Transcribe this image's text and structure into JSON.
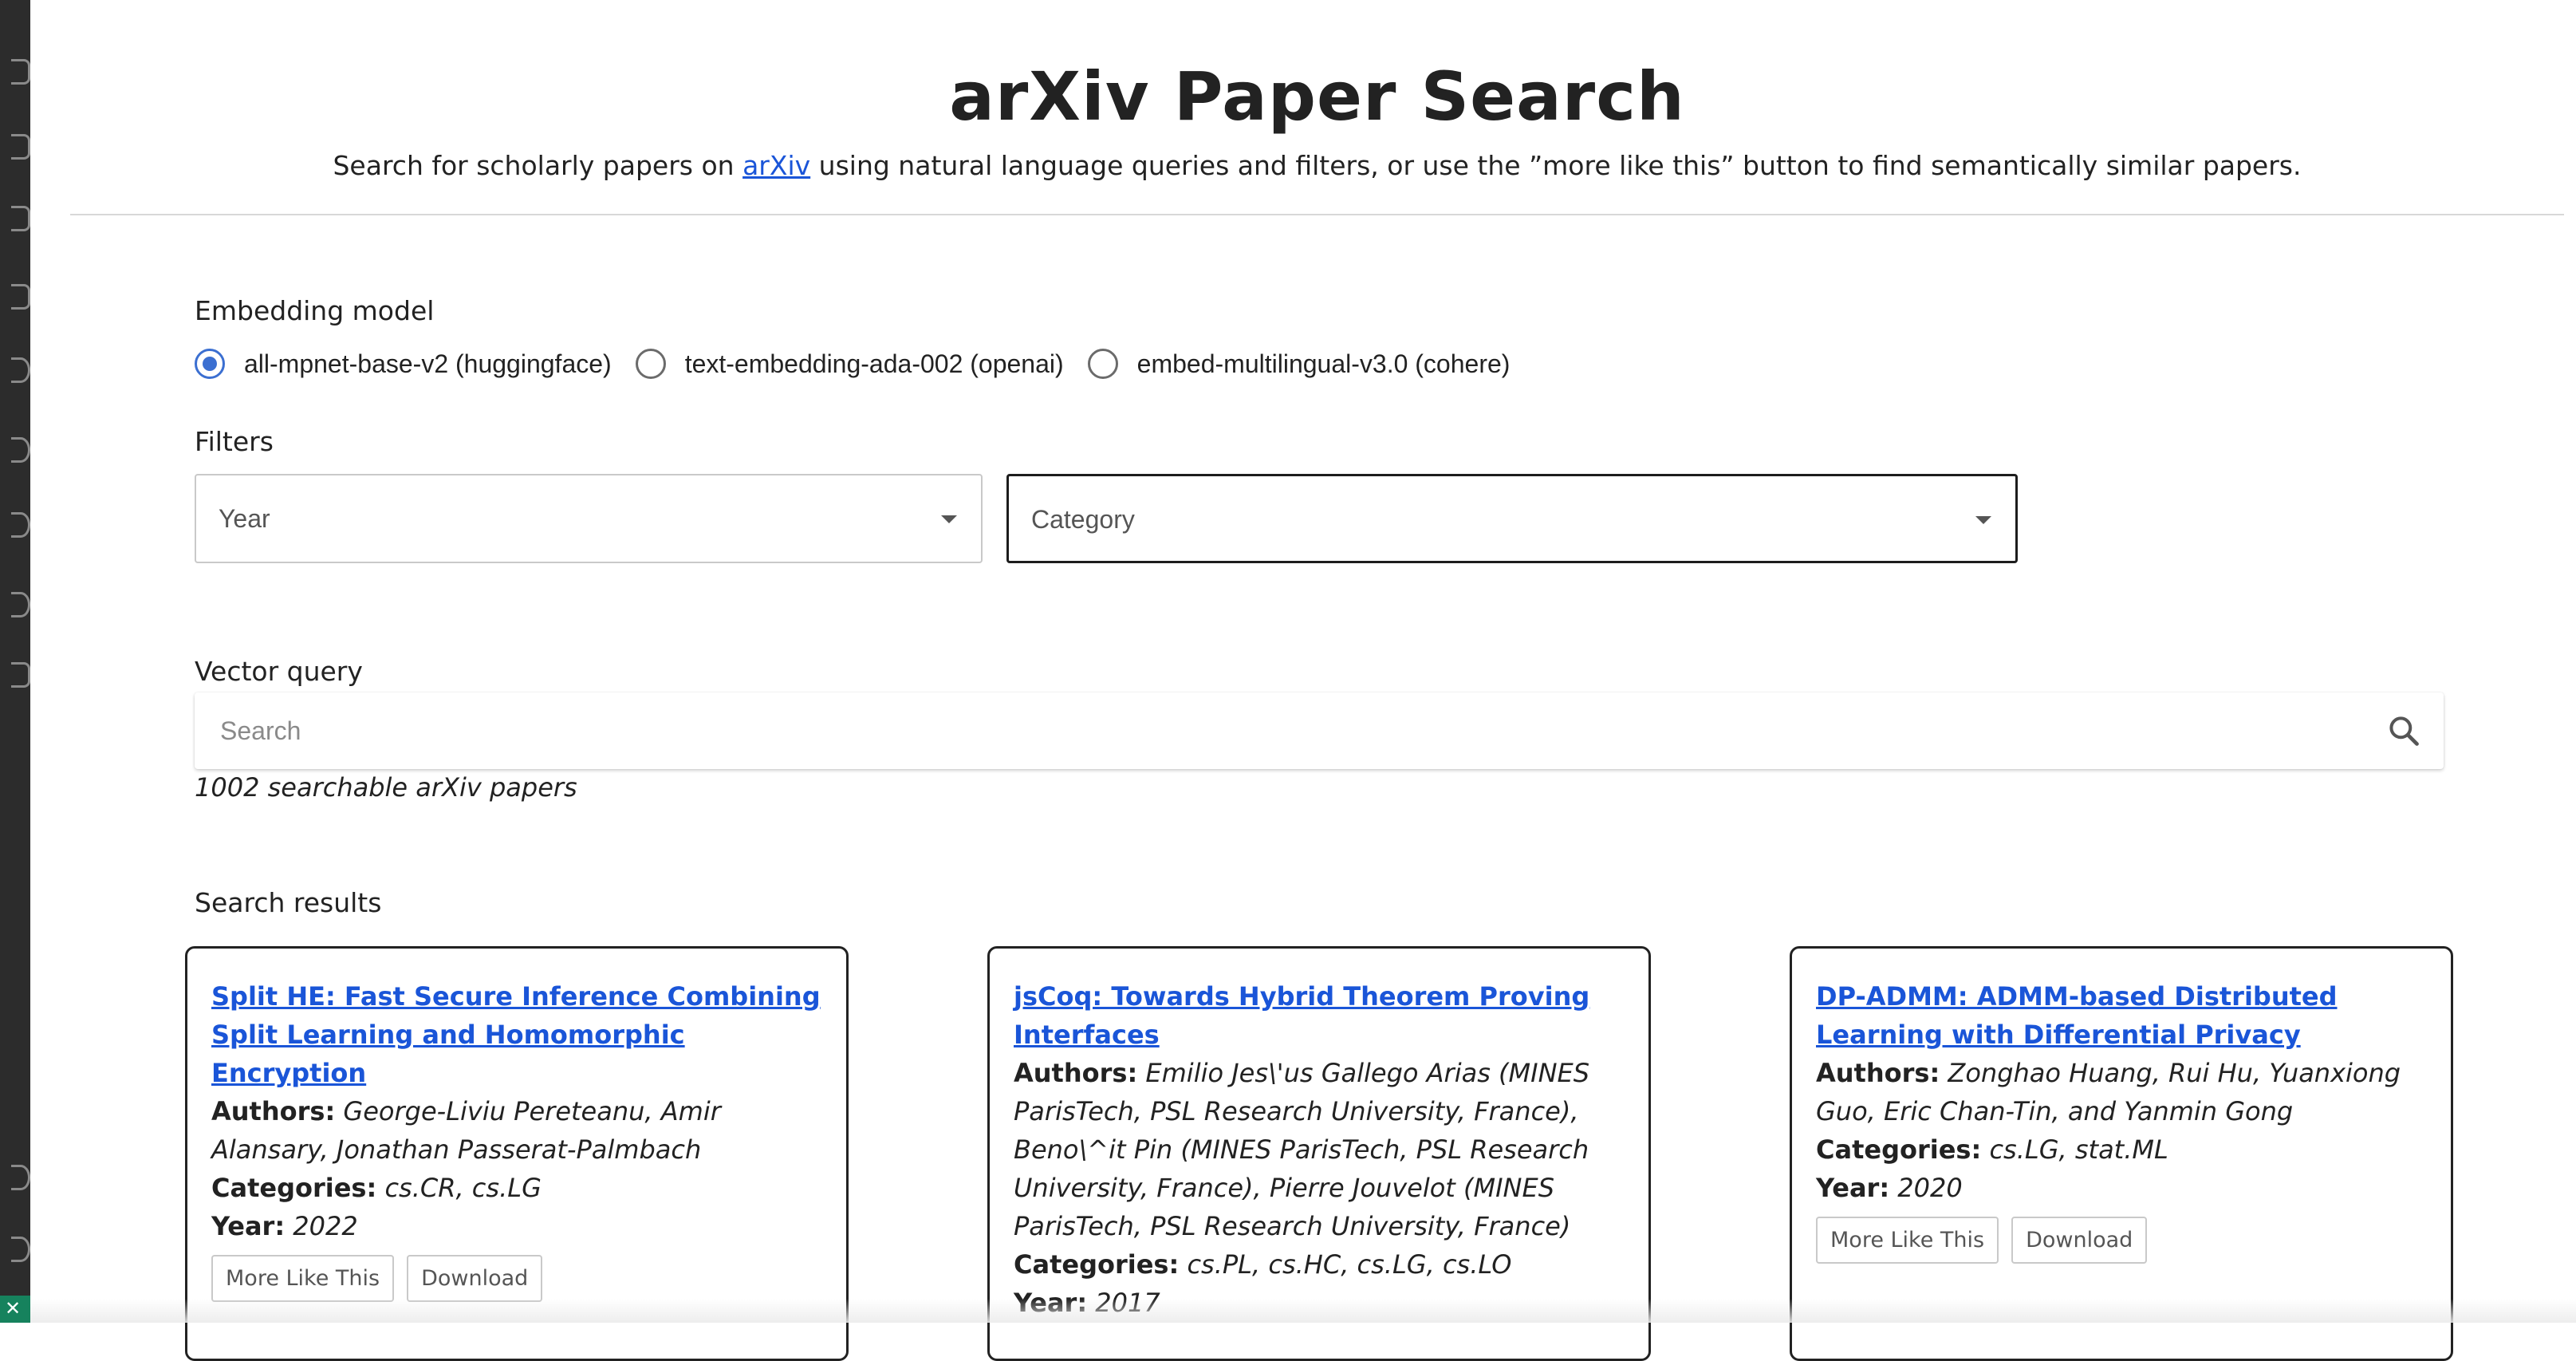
{
  "header": {
    "title": "arXiv Paper Search",
    "subtitle_before": "Search for scholarly papers on ",
    "subtitle_link": "arXiv",
    "subtitle_after": " using natural language queries and filters, or use the ”more like this” button to find semantically similar papers."
  },
  "embedding": {
    "label": "Embedding model",
    "options": [
      {
        "label": "all-mpnet-base-v2 (huggingface)",
        "selected": true
      },
      {
        "label": "text-embedding-ada-002 (openai)",
        "selected": false
      },
      {
        "label": "embed-multilingual-v3.0 (cohere)",
        "selected": false
      }
    ]
  },
  "filters": {
    "label": "Filters",
    "year": {
      "placeholder": "Year"
    },
    "category": {
      "placeholder": "Category"
    }
  },
  "vector_query": {
    "label": "Vector query",
    "placeholder": "Search",
    "value": ""
  },
  "count_text": "1002 searchable arXiv papers",
  "results": {
    "label": "Search results",
    "labels": {
      "authors": "Authors:",
      "categories": "Categories:",
      "year": "Year:"
    },
    "buttons": {
      "more_like_this": "More Like This",
      "download": "Download"
    },
    "cards": [
      {
        "title": "Split HE: Fast Secure Inference Combining Split Learning and Homomorphic Encryption",
        "authors": "George-Liviu Pereteanu, Amir Alansary, Jonathan Passerat-Palmbach",
        "categories": "cs.CR, cs.LG",
        "year": "2022"
      },
      {
        "title": "jsCoq: Towards Hybrid Theorem Proving Interfaces",
        "authors": "Emilio Jes\\'us Gallego Arias (MINES ParisTech, PSL Research University, France), Beno\\^it Pin (MINES ParisTech, PSL Research University, France), Pierre Jouvelot (MINES ParisTech, PSL Research University, France)",
        "categories": "cs.PL, cs.HC, cs.LG, cs.LO",
        "year": "2017"
      },
      {
        "title": "DP-ADMM: ADMM-based Distributed Learning with Differential Privacy",
        "authors": "Zonghao Huang, Rui Hu, Yuanxiong Guo, Eric Chan-Tin, and Yanmin Gong",
        "categories": "cs.LG, stat.ML",
        "year": "2020"
      }
    ]
  },
  "colors": {
    "link": "#1a55d8",
    "radio_selected": "#3b6fd1",
    "activity_bar": "#2c2c2c",
    "status_green": "#16825d"
  },
  "icons": {
    "search": "search-icon",
    "dropdown": "chevron-down-icon"
  }
}
